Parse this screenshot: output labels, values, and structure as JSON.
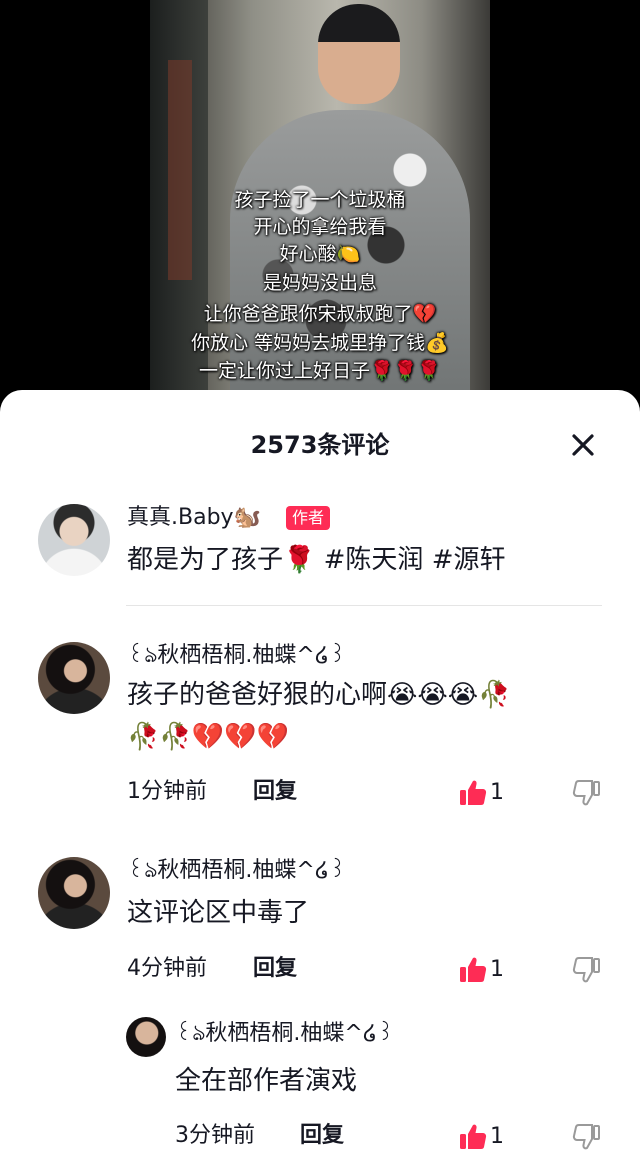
{
  "video": {
    "captions": [
      "孩子捡了一个垃圾桶",
      "开心的拿给我看",
      "好心酸🍋",
      "是妈妈没出息",
      "让你爸爸跟你宋叔叔跑了💔",
      "你放心 等妈妈去城里挣了钱💰",
      "一定让你过上好日子🌹🌹🌹"
    ]
  },
  "comments_panel": {
    "title": "2573条评论",
    "close_icon": "close-icon"
  },
  "author_comment": {
    "username": "真真.Baby🐿️",
    "badge": "作者",
    "text": "都是为了孩子🌹 #陈天润 #源轩"
  },
  "comments": [
    {
      "username": "꒰ঌ秋栖梧桐.柚蝶^໒꒱",
      "text_line1": "孩子的爸爸好狠的心啊😭😭😭🥀",
      "text_line2": "🥀🥀💔💔💔",
      "time": "1分钟前",
      "reply_label": "回复",
      "likes": "1"
    },
    {
      "username": "꒰ঌ秋栖梧桐.柚蝶^໒꒱",
      "text_line1": "这评论区中毒了",
      "time": "4分钟前",
      "reply_label": "回复",
      "likes": "1"
    }
  ],
  "reply": {
    "username": "꒰ঌ秋栖梧桐.柚蝶^໒꒱",
    "text": "全在部作者演戏",
    "time": "3分钟前",
    "reply_label": "回复",
    "likes": "1"
  },
  "colors": {
    "accent": "#fe2c55",
    "text": "#161823",
    "muted_icon": "#9a9a9a"
  }
}
